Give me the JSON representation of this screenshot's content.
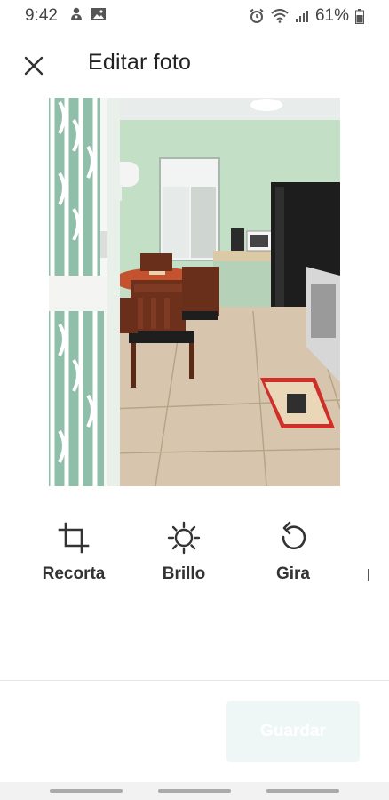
{
  "status_bar": {
    "time": "9:42",
    "battery": "61%"
  },
  "header": {
    "title": "Editar foto"
  },
  "photo": {
    "subject": "kitchen-dining-room"
  },
  "tools": [
    {
      "label": "Recorta",
      "icon": "crop-icon"
    },
    {
      "label": "Brillo",
      "icon": "brightness-icon"
    },
    {
      "label": "Gira",
      "icon": "rotate-icon"
    }
  ],
  "footer": {
    "save_label": "Guardar"
  },
  "colors": {
    "save_button_bg": "#eef7f5",
    "wall": "#b8d9bd",
    "floor": "#d7c6ad"
  }
}
